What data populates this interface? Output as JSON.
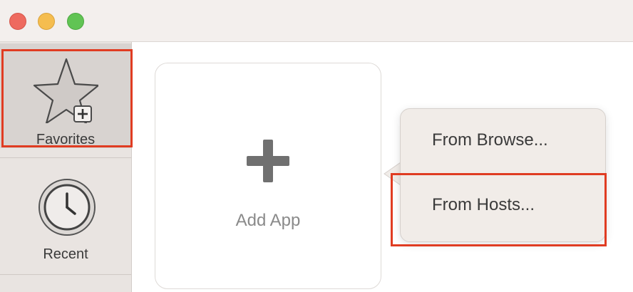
{
  "sidebar": {
    "items": [
      {
        "label": "Favorites",
        "icon": "star-plus-icon",
        "selected": true
      },
      {
        "label": "Recent",
        "icon": "clock-icon",
        "selected": false
      }
    ]
  },
  "main": {
    "add_card": {
      "label": "Add App",
      "icon": "plus-icon"
    }
  },
  "popover_menu": {
    "items": [
      {
        "label": "From Browse..."
      },
      {
        "label": "From Hosts..."
      }
    ]
  },
  "colors": {
    "highlight": "#e03c22",
    "traffic_close": "#ee6a5f",
    "traffic_minimize": "#f5bd4f",
    "traffic_maximize": "#61c454"
  }
}
